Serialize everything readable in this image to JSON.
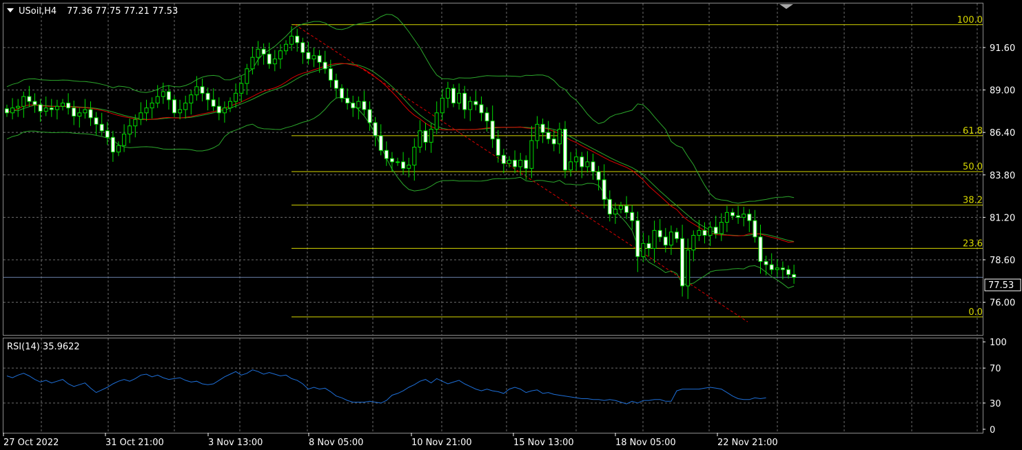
{
  "window": {
    "symbol_label": "USoil,H4",
    "ohlc_label": "77.36 77.75 77.21 77.53",
    "current_price_label": "77.53"
  },
  "rsi_panel": {
    "label": "RSI(14) 35.9622",
    "y_ticks": [
      "100",
      "70",
      "30",
      "0"
    ]
  },
  "colors": {
    "background": "#000000",
    "grid": "#6e6e6e",
    "candle_up": "#00e000",
    "candle_down_fill": "#ffffff",
    "bollinger": "#2ca82c",
    "moving_average": "#e00000",
    "fibonacci": "#d8d800",
    "trendline": "#e00000",
    "rsi_line": "#1e6fd8",
    "price_line": "#6a7fa8",
    "text": "#ffffff"
  },
  "chart_data": [
    {
      "type": "candlestick",
      "title": "USoil,H4",
      "ylim": [
        74.0,
        94.3
      ],
      "y_ticks": [
        "91.60",
        "89.00",
        "86.40",
        "83.80",
        "81.20",
        "78.60",
        "76.00"
      ],
      "y_tick_values": [
        91.6,
        89.0,
        86.4,
        83.8,
        81.2,
        78.6,
        76.0
      ],
      "x_tick_labels": [
        "27 Oct 2022",
        "31 Oct 21:00",
        "3 Nov 13:00",
        "8 Nov 05:00",
        "10 Nov 21:00",
        "15 Nov 13:00",
        "18 Nov 05:00",
        "22 Nov 21:00"
      ],
      "current_price": 77.53,
      "fibonacci": {
        "levels": [
          {
            "label": "100.0",
            "value": 93.0
          },
          {
            "label": "61.8",
            "value": 86.2
          },
          {
            "label": "50.0",
            "value": 84.0
          },
          {
            "label": "38.2",
            "value": 81.95
          },
          {
            "label": "23.6",
            "value": 79.3
          },
          {
            "label": "0.0",
            "value": 75.1
          }
        ]
      },
      "close": [
        87.6,
        87.9,
        88.0,
        88.6,
        88.3,
        88.1,
        87.7,
        87.9,
        87.8,
        88.0,
        88.2,
        87.9,
        87.4,
        87.6,
        87.8,
        87.3,
        86.9,
        86.5,
        86.1,
        85.2,
        85.6,
        86.3,
        86.8,
        87.2,
        87.6,
        87.9,
        88.2,
        88.6,
        88.9,
        88.4,
        87.6,
        87.8,
        88.2,
        88.7,
        89.2,
        88.8,
        88.4,
        88.0,
        87.6,
        87.9,
        88.3,
        88.8,
        89.4,
        90.3,
        91.0,
        91.5,
        91.2,
        90.6,
        90.9,
        91.4,
        91.8,
        92.3,
        91.9,
        91.3,
        90.9,
        91.1,
        90.7,
        90.3,
        89.6,
        89.1,
        88.5,
        88.2,
        87.9,
        88.3,
        87.8,
        87.0,
        86.2,
        85.3,
        84.8,
        84.6,
        84.6,
        84.2,
        84.4,
        85.5,
        86.5,
        85.8,
        86.6,
        87.6,
        88.5,
        89.1,
        88.2,
        88.8,
        87.8,
        88.3,
        88.1,
        87.6,
        87.1,
        86.0,
        85.0,
        84.5,
        84.7,
        84.3,
        84.7,
        84.2,
        85.9,
        86.9,
        86.4,
        86.0,
        85.7,
        86.6,
        84.1,
        84.6,
        84.9,
        84.3,
        84.6,
        84.0,
        83.5,
        82.3,
        81.4,
        81.7,
        81.9,
        81.5,
        81.0,
        78.8,
        79.6,
        79.3,
        80.4,
        80.0,
        79.5,
        80.3,
        79.9,
        77.0,
        79.2,
        80.1,
        80.4,
        80.1,
        80.6,
        80.2,
        80.9,
        81.5,
        81.3,
        81.2,
        81.4,
        81.0,
        80.0,
        78.5,
        78.3,
        78.0,
        78.1,
        78.0,
        77.7,
        77.53
      ],
      "rsi": [
        61,
        59,
        62,
        64,
        61,
        57,
        54,
        56,
        53,
        55,
        57,
        52,
        49,
        51,
        53,
        47,
        42,
        45,
        48,
        52,
        55,
        57,
        55,
        58,
        62,
        63,
        60,
        62,
        59,
        57,
        58,
        59,
        56,
        54,
        55,
        52,
        51,
        52,
        56,
        60,
        63,
        66,
        62,
        64,
        68,
        66,
        63,
        65,
        63,
        61,
        62,
        58,
        56,
        52,
        46,
        48,
        46,
        47,
        43,
        38,
        36,
        33,
        31,
        31,
        31,
        32,
        31,
        30,
        33,
        39,
        41,
        44,
        48,
        51,
        55,
        57,
        53,
        58,
        55,
        52,
        54,
        56,
        52,
        49,
        46,
        44,
        46,
        44,
        43,
        41,
        46,
        48,
        46,
        42,
        44,
        45,
        41,
        42,
        40,
        39,
        38,
        37,
        36,
        35,
        35,
        34,
        34,
        33,
        34,
        33,
        31,
        29,
        32,
        30,
        33,
        33,
        34,
        34,
        32,
        32,
        44,
        46,
        46,
        46,
        46,
        47,
        48,
        47,
        46,
        42,
        38,
        35,
        34,
        34,
        36,
        35,
        35.96
      ]
    }
  ]
}
